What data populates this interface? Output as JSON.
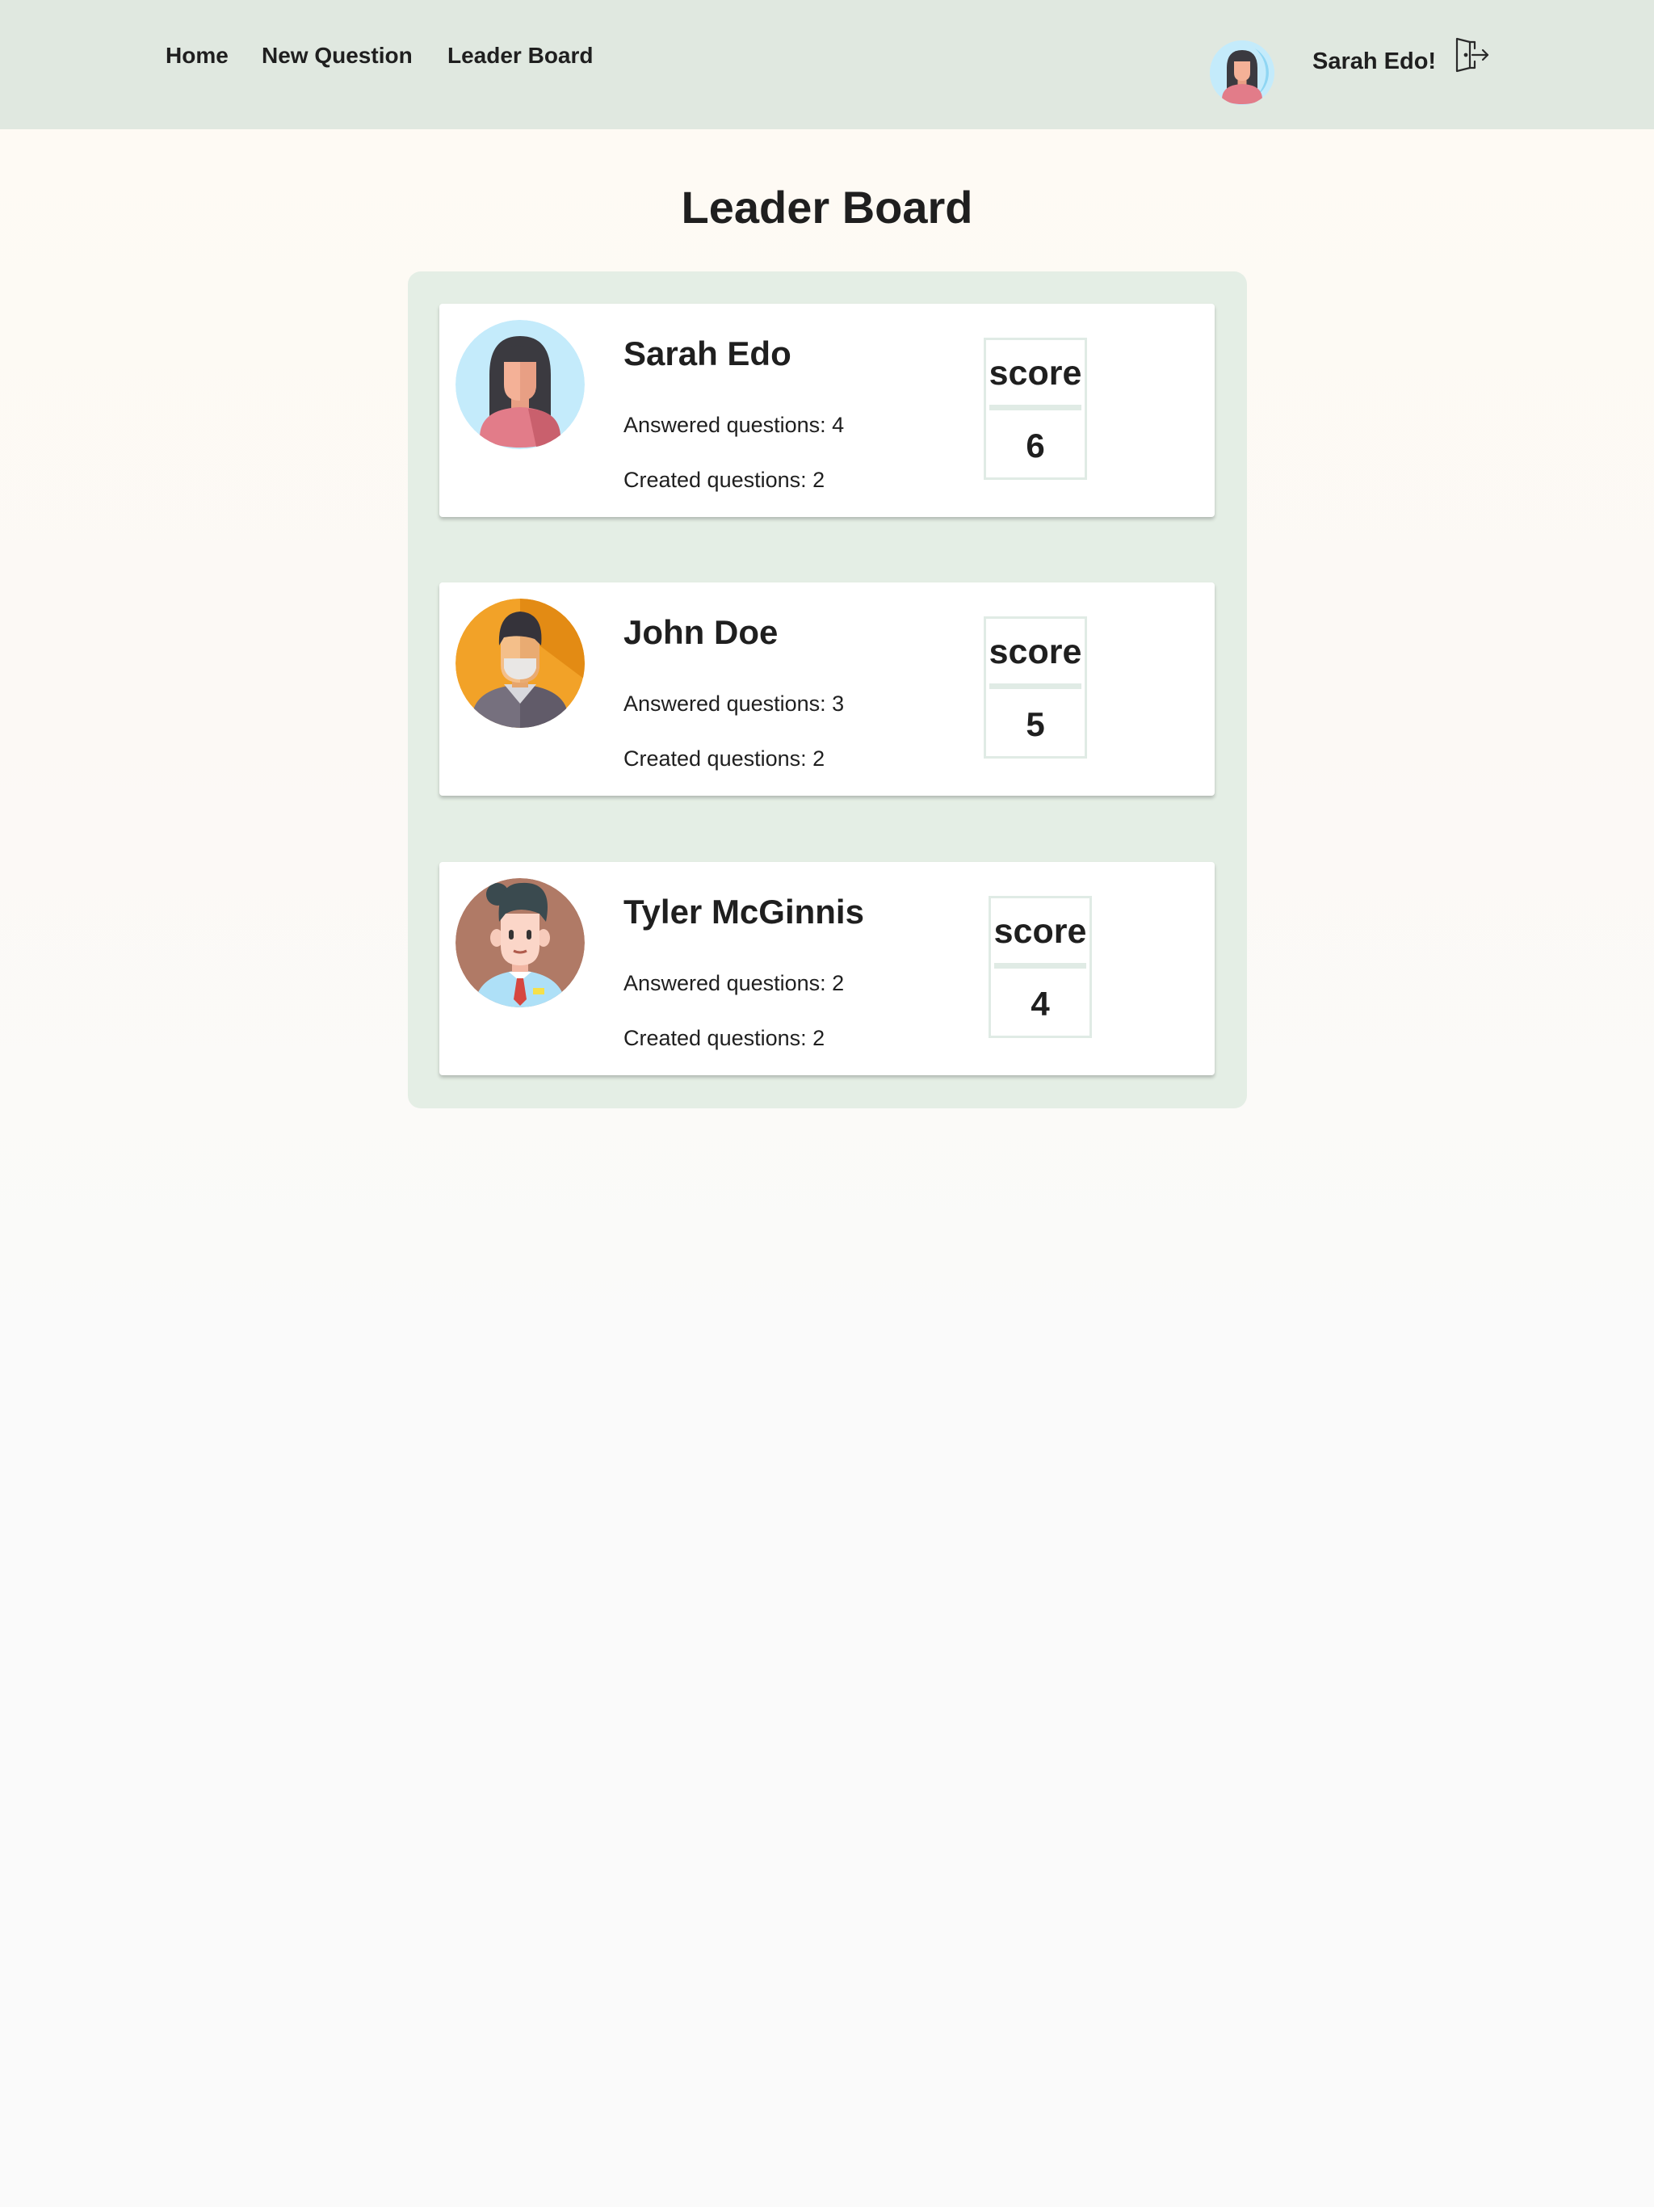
{
  "nav": {
    "items": [
      {
        "label": "Home"
      },
      {
        "label": "New Question"
      },
      {
        "label": "Leader Board"
      }
    ],
    "user_greeting": "Sarah Edo!",
    "logout_icon": "logout-icon"
  },
  "page": {
    "title": "Leader Board"
  },
  "leaderboard": [
    {
      "name": "Sarah Edo",
      "answered": "Answered questions: 4",
      "created": "Created questions: 2",
      "score_label": "score",
      "score": "6"
    },
    {
      "name": "John Doe",
      "answered": "Answered questions: 3",
      "created": "Created questions: 2",
      "score_label": "score",
      "score": "5"
    },
    {
      "name": "Tyler McGinnis",
      "answered": "Answered questions: 2",
      "created": "Created questions: 2",
      "score_label": "score",
      "score": "4"
    }
  ],
  "colors": {
    "header_bg": "#e0e8e0",
    "board_bg": "#e4eee5",
    "card_bg": "#ffffff",
    "score_border": "#e0ebe5",
    "text": "#1f1f1f"
  }
}
